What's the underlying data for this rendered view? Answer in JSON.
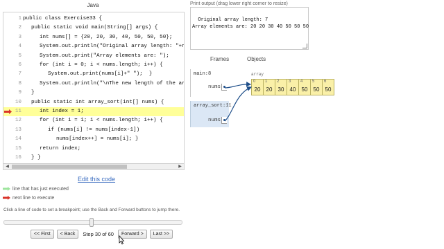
{
  "code_panel": {
    "language": "Java",
    "lines": [
      {
        "no": "1",
        "text": "public class Exercise33 {",
        "indent": 0,
        "marker": ""
      },
      {
        "no": "2",
        "text": "public static void main(String[] args) {",
        "indent": 1,
        "marker": ""
      },
      {
        "no": "3",
        "text": "int nums[] = {20, 20, 30, 40, 50, 50, 50};",
        "indent": 2,
        "marker": ""
      },
      {
        "no": "4",
        "text": "System.out.println(\"Original array length: \"+nums.len",
        "indent": 2,
        "marker": ""
      },
      {
        "no": "5",
        "text": "System.out.print(\"Array elements are: \");",
        "indent": 2,
        "marker": ""
      },
      {
        "no": "6",
        "text": "for (int i = 0; i < nums.length; i++) {",
        "indent": 2,
        "marker": ""
      },
      {
        "no": "7",
        "text": "System.out.print(nums[i]+\" \");  }",
        "indent": 3,
        "marker": ""
      },
      {
        "no": "8",
        "text": "System.out.println(\"\\nThe new length of the array is:",
        "indent": 2,
        "marker": ""
      },
      {
        "no": "9",
        "text": "}",
        "indent": 1,
        "marker": ""
      },
      {
        "no": "10",
        "text": "public static int array_sort(int[] nums) {",
        "indent": 1,
        "marker": ""
      },
      {
        "no": "11",
        "text": "int index = 1;",
        "indent": 2,
        "marker": "next"
      },
      {
        "no": "12",
        "text": "for (int i = 1; i < nums.length; i++) {",
        "indent": 2,
        "marker": ""
      },
      {
        "no": "13",
        "text": "if (nums[i] != nums[index-1])",
        "indent": 3,
        "marker": ""
      },
      {
        "no": "14",
        "text": "nums[index++] = nums[i]; }",
        "indent": 4,
        "marker": ""
      },
      {
        "no": "15",
        "text": "return index;",
        "indent": 2,
        "marker": ""
      },
      {
        "no": "16",
        "text": "} }",
        "indent": 1,
        "marker": ""
      }
    ],
    "edit_link": "Edit this code",
    "legend_executed": "line that has just executed",
    "legend_next": "next line to execute",
    "help_text": "Click a line of code to set a breakpoint; use the Back and Forward buttons to jump there.",
    "slider_fraction": 0.4915
  },
  "nav": {
    "first": "<< First",
    "back": "< Back",
    "step": "Step 30 of 60",
    "forward": "Forward >",
    "last": "Last >>"
  },
  "output": {
    "label": "Print output (drag lower right corner to resize)",
    "text": "Original array length: 7\nArray elements are: 20 20 30 40 50 50 50"
  },
  "visual": {
    "frames_header": "Frames",
    "objects_header": "Objects",
    "frames": [
      {
        "name": "main:8",
        "var": "nums"
      },
      {
        "name": "array_sort:11",
        "var": "nums"
      }
    ],
    "array_label": "array",
    "array": [
      {
        "index": "0",
        "value": "20"
      },
      {
        "index": "1",
        "value": "20"
      },
      {
        "index": "2",
        "value": "30"
      },
      {
        "index": "3",
        "value": "40"
      },
      {
        "index": "4",
        "value": "50"
      },
      {
        "index": "5",
        "value": "50"
      },
      {
        "index": "6",
        "value": "50"
      }
    ]
  },
  "colors": {
    "executed_arrow": "#9ee59e",
    "next_arrow": "#d9342b",
    "pointer": "#1f4f8a",
    "current_frame": "#dbe7f5",
    "array_cell": "#faf0a8",
    "link": "#3a6cc0"
  }
}
